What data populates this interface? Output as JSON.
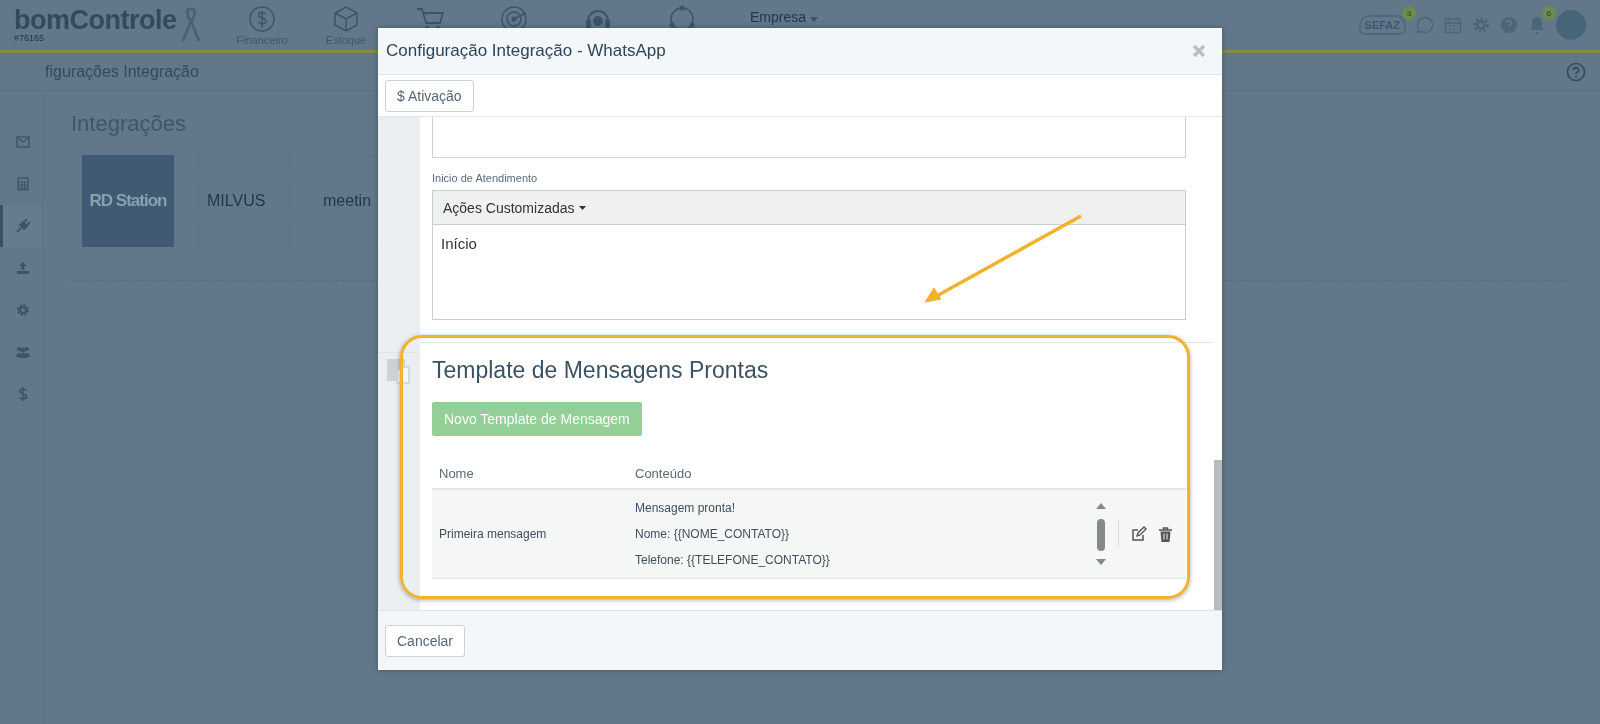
{
  "header": {
    "logo": "bomControle",
    "account": "#76165",
    "nav": [
      {
        "kind": "dollar",
        "label": "Financeiro"
      },
      {
        "kind": "box",
        "label": "Estoque"
      },
      {
        "kind": "cart"
      },
      {
        "kind": "target"
      },
      {
        "kind": "headset"
      },
      {
        "kind": "cycle"
      }
    ],
    "company_menu": "Empresa",
    "sefaz": {
      "label": "SEFAZ",
      "badge": "3"
    },
    "notifications_badge": "6"
  },
  "breadcrumb": "figurações Integração",
  "sidebar": {
    "items": [
      {
        "kind": "mail",
        "selected": false
      },
      {
        "kind": "calculator",
        "selected": false
      },
      {
        "kind": "plug",
        "selected": true
      },
      {
        "kind": "upload",
        "selected": false
      },
      {
        "kind": "gear",
        "selected": false
      },
      {
        "kind": "users",
        "selected": false
      },
      {
        "kind": "dollar",
        "selected": false
      }
    ]
  },
  "page_title": "Integrações",
  "integrations": [
    {
      "label": "RD Station",
      "selected": true
    },
    {
      "label": "MILVUS",
      "selected": false
    },
    {
      "label": "meetin",
      "selected": false
    }
  ],
  "modal": {
    "title": "Configuração Integração - WhatsApp",
    "toolbar_button": {
      "icon_text": "$",
      "label": "Ativação"
    },
    "field_label": "Inicio de Atendimento",
    "editor": {
      "menu": "Ações Customizadas",
      "content": "Início"
    },
    "templates": {
      "title": "Template de Mensagens Prontas",
      "new_button": "Novo Template de Mensagem",
      "columns": [
        "Nome",
        "Conteúdo"
      ],
      "rows": [
        {
          "name": "Primeira mensagem",
          "content": [
            "Mensagem pronta!",
            "Nome: {{NOME_CONTATO}}",
            "Telefone: {{TELEFONE_CONTATO}}"
          ]
        }
      ]
    },
    "footer_button": "Cancelar"
  }
}
